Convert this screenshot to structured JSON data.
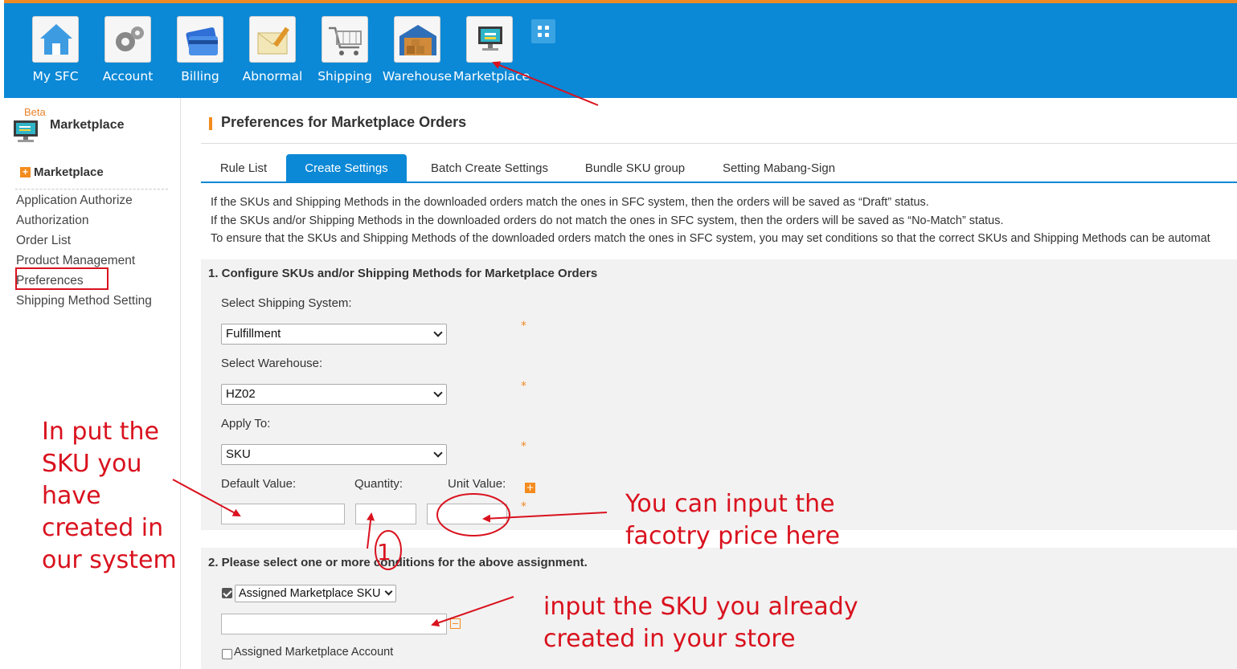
{
  "nav": {
    "items": [
      {
        "label": "My SFC",
        "icon": "home-icon"
      },
      {
        "label": "Account",
        "icon": "gears-icon"
      },
      {
        "label": "Billing",
        "icon": "credit-card-icon"
      },
      {
        "label": "Abnormal",
        "icon": "envelope-pencil-icon"
      },
      {
        "label": "Shipping",
        "icon": "shopping-cart-icon"
      },
      {
        "label": "Warehouse",
        "icon": "warehouse-icon"
      },
      {
        "label": "Marketplace",
        "icon": "monitor-icon"
      }
    ],
    "apps_icon": "grid-icon"
  },
  "sidebar": {
    "beta": "Beta",
    "title": "Marketplace",
    "section": "Marketplace",
    "links": [
      "Application Authorize",
      "Authorization",
      "Order List",
      "Product Management",
      "Preferences",
      "Shipping Method Setting"
    ]
  },
  "main": {
    "title": "Preferences for Marketplace Orders",
    "tabs": [
      "Rule List",
      "Create Settings",
      "Batch Create Settings",
      "Bundle SKU group",
      "Setting Mabang-Sign"
    ],
    "active_tab": "Create Settings",
    "info": [
      "If the SKUs and Shipping Methods in the downloaded orders match the ones in SFC system, then the orders will be saved as “Draft” status.",
      "If the SKUs and/or Shipping Methods in the downloaded orders do not match the ones in SFC system, then the orders will be saved as “No-Match” status.",
      "To ensure that the SKUs and Shipping Methods of the downloaded orders match the ones in SFC system, you may set conditions so that the correct SKUs and Shipping Methods can be automat"
    ],
    "section1": {
      "heading": "1. Configure SKUs and/or Shipping Methods for Marketplace Orders",
      "shipping_system_label": "Select Shipping System:",
      "shipping_system_value": "Fulfillment",
      "warehouse_label": "Select Warehouse:",
      "warehouse_value": "HZ02",
      "apply_to_label": "Apply To:",
      "apply_to_value": "SKU",
      "default_value_label": "Default Value:",
      "quantity_label": "Quantity:",
      "unit_value_label": "Unit Value:",
      "required_mark": "*"
    },
    "section2": {
      "heading": "2. Please select one or more conditions for the above assignment.",
      "condition_select_value": "Assigned Marketplace SKU",
      "condition_checked": true,
      "account_label": "Assigned Marketplace Account",
      "account_checked": false
    }
  },
  "annotations": {
    "left_note": [
      "In put the",
      "SKU you",
      "have",
      "created in",
      "our system"
    ],
    "price_note": [
      "You can input the",
      "facotry price here"
    ],
    "sku_note": [
      "input the SKU you already",
      "created in your store"
    ],
    "circle_number": "1"
  },
  "colors": {
    "nav_blue": "#0b88d6",
    "accent_orange": "#f48b1d",
    "annotation_red": "#d9121e"
  }
}
